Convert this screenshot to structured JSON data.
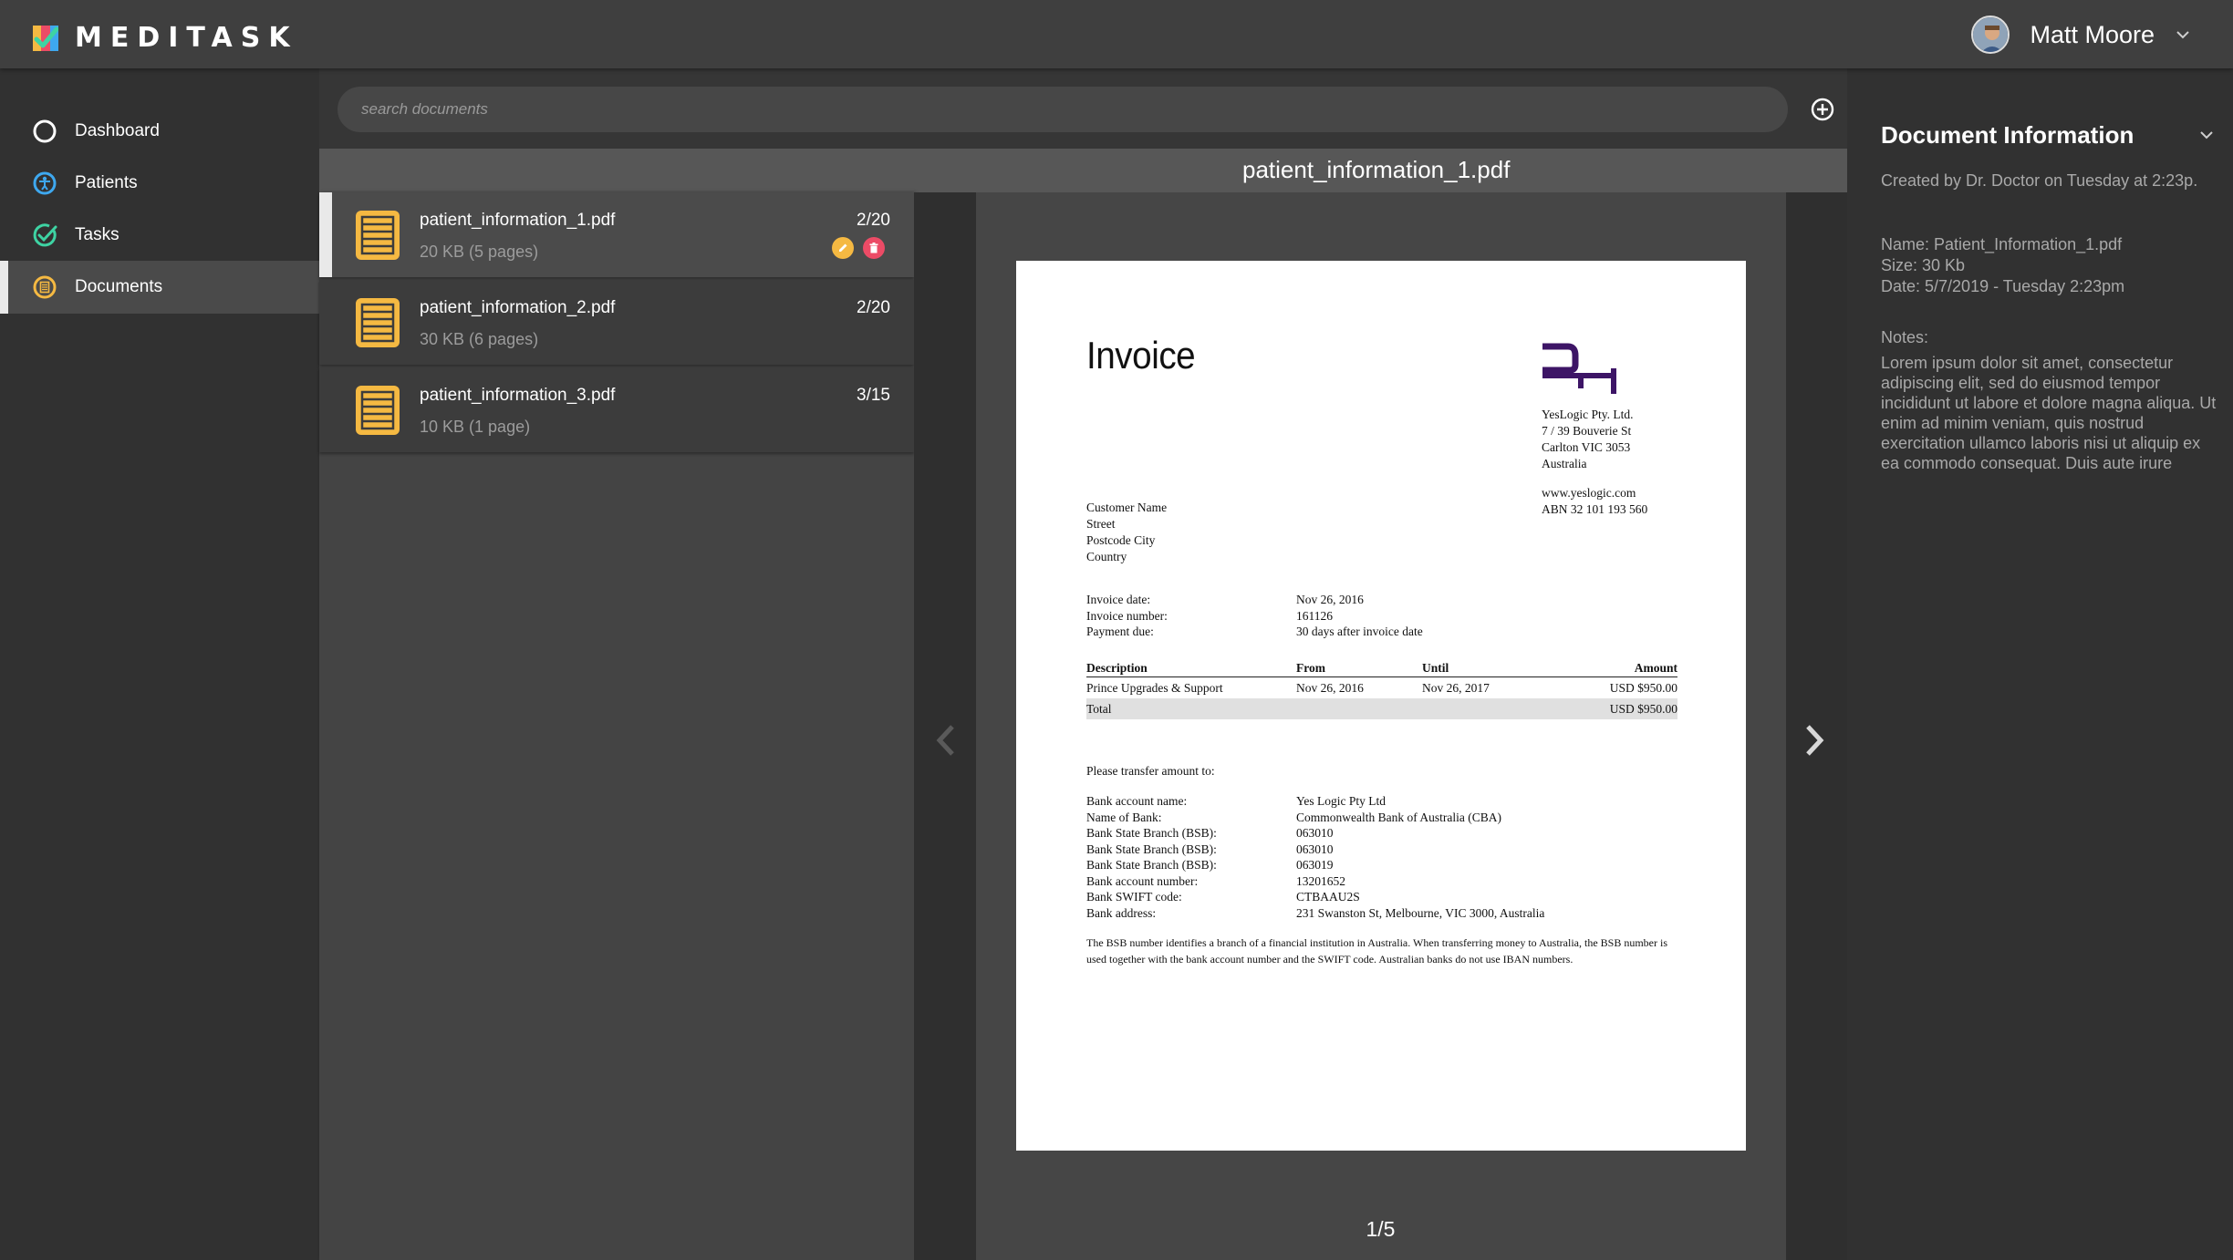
{
  "app": {
    "name": "MEDITASK"
  },
  "user": {
    "name": "Matt Moore"
  },
  "nav": {
    "items": [
      {
        "label": "Dashboard",
        "icon": "circle-outline-icon"
      },
      {
        "label": "Patients",
        "icon": "person-icon"
      },
      {
        "label": "Tasks",
        "icon": "check-circle-icon"
      },
      {
        "label": "Documents",
        "icon": "document-icon",
        "active": true
      }
    ]
  },
  "search": {
    "placeholder": "search documents"
  },
  "files": [
    {
      "name": "patient_information_1.pdf",
      "meta": "20 KB (5 pages)",
      "count": "2/20",
      "active": true
    },
    {
      "name": "patient_information_2.pdf",
      "meta": "30 KB (6 pages)",
      "count": "2/20"
    },
    {
      "name": "patient_information_3.pdf",
      "meta": "10 KB (1 page)",
      "count": "3/15"
    }
  ],
  "viewer": {
    "title": "patient_information_1.pdf",
    "page_indicator": "1/5"
  },
  "invoice": {
    "title": "Invoice",
    "company": {
      "name": "YesLogic Pty. Ltd.",
      "street": "7 / 39 Bouverie St",
      "city": "Carlton VIC 3053",
      "country": "Australia",
      "web": "www.yeslogic.com",
      "abn": "ABN 32 101 193 560"
    },
    "customer": {
      "name": "Customer Name",
      "street": "Street",
      "postcode": "Postcode City",
      "country": "Country"
    },
    "details": [
      {
        "k": "Invoice date:",
        "v": "Nov 26, 2016"
      },
      {
        "k": "Invoice number:",
        "v": "161126"
      },
      {
        "k": "Payment due:",
        "v": "30 days after invoice date"
      }
    ],
    "table": {
      "headers": {
        "desc": "Description",
        "from": "From",
        "until": "Until",
        "amount": "Amount"
      },
      "rows": [
        {
          "desc": "Prince Upgrades & Support",
          "from": "Nov 26, 2016",
          "until": "Nov 26, 2017",
          "amount": "USD $950.00"
        }
      ],
      "total": {
        "label": "Total",
        "amount": "USD $950.00"
      }
    },
    "transfer_label": "Please transfer amount to:",
    "bank": [
      {
        "k": "Bank account name:",
        "v": "Yes Logic Pty Ltd"
      },
      {
        "k": "Name of Bank:",
        "v": "Commonwealth Bank of Australia (CBA)"
      },
      {
        "k": "Bank State Branch (BSB):",
        "v": "063010"
      },
      {
        "k": "Bank State Branch (BSB):",
        "v": "063010"
      },
      {
        "k": "Bank State Branch (BSB):",
        "v": "063019"
      },
      {
        "k": "Bank account number:",
        "v": "13201652"
      },
      {
        "k": "Bank SWIFT code:",
        "v": "CTBAAU2S"
      },
      {
        "k": "Bank address:",
        "v": "231 Swanston St, Melbourne, VIC 3000, Australia"
      }
    ],
    "footnote": "The BSB number identifies a branch of a financial institution in Australia. When transferring money to Australia, the BSB number is used together with the bank account number and the SWIFT code. Australian banks do not use IBAN numbers."
  },
  "info": {
    "title": "Document Information",
    "created": "Created by Dr. Doctor on Tuesday at 2:23p.",
    "name": "Name: Patient_Information_1.pdf",
    "size": "Size: 30 Kb",
    "date": "Date: 5/7/2019 - Tuesday 2:23pm",
    "notes_label": "Notes:",
    "notes": "Lorem ipsum dolor sit amet, consectetur adipiscing elit, sed do eiusmod tempor incididunt ut labore et dolore magna aliqua. Ut enim ad minim veniam, quis nostrud exercitation ullamco laboris nisi ut aliquip ex ea commodo consequat. Duis aute irure"
  },
  "colors": {
    "accent_yellow": "#f5b942",
    "accent_blue": "#3ea8ef",
    "accent_green": "#3ed3a3",
    "delete_red": "#ec4b66",
    "logo_purple": "#3d1566"
  }
}
